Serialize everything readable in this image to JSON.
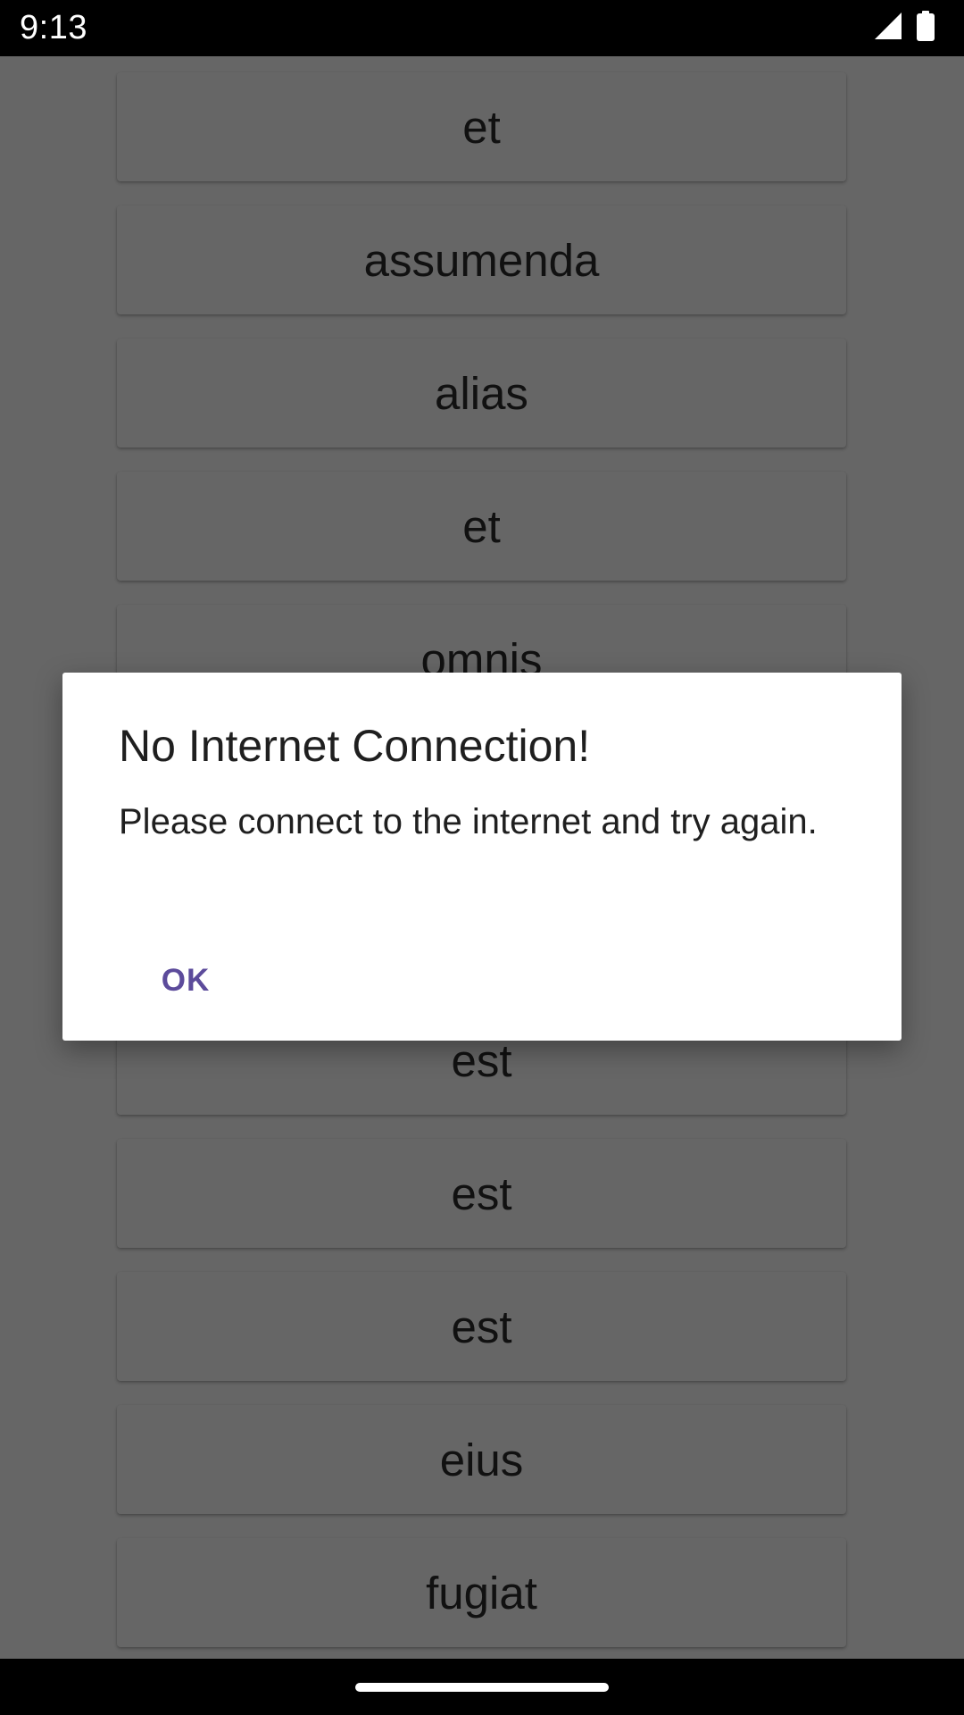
{
  "status_bar": {
    "time": "9:13",
    "icons": [
      "cellular-signal-icon",
      "battery-icon"
    ]
  },
  "list": {
    "items": [
      "et",
      "assumenda",
      "alias",
      "et",
      "omnis",
      "",
      "",
      "est",
      "est",
      "est",
      "eius",
      "fugiat"
    ]
  },
  "dialog": {
    "title": "No Internet Connection!",
    "message": "Please connect to the internet and try again.",
    "ok_label": "OK"
  },
  "colors": {
    "status_bar": "#000000",
    "scrim": "rgba(0,0,0,0.6)",
    "dialog_button": "#5c4b9b"
  }
}
